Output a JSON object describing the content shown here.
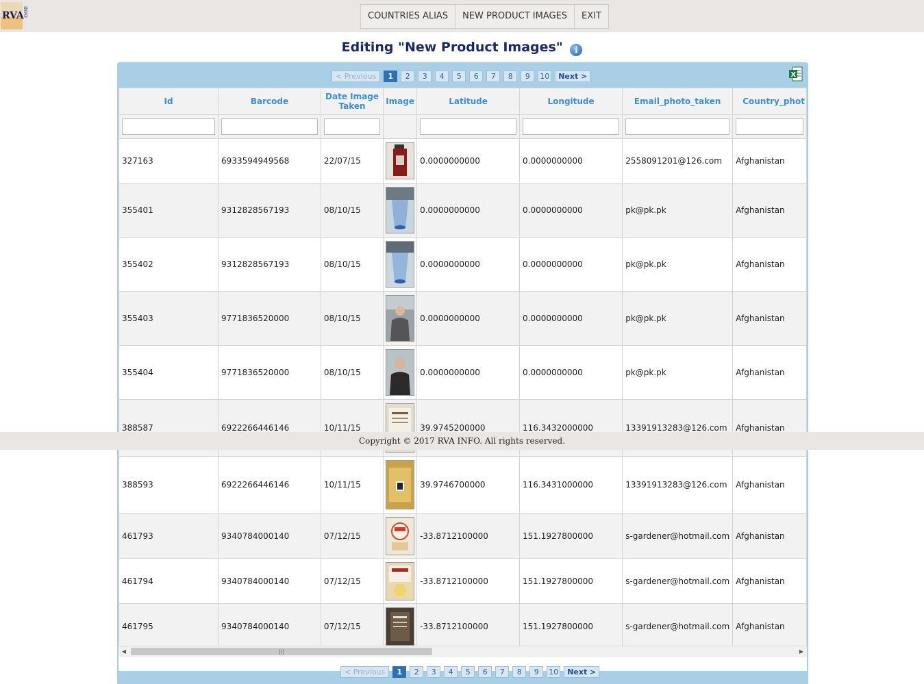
{
  "app": {
    "logo_text": "RVA INFO"
  },
  "nav": {
    "items": [
      "COUNTRIES ALIAS",
      "NEW PRODUCT IMAGES",
      "EXIT"
    ]
  },
  "page_title": "Editing \"New Product Images\"",
  "pager": {
    "prev_label": "< Previous",
    "next_label": "Next >",
    "pages": [
      "1",
      "2",
      "3",
      "4",
      "5",
      "6",
      "7",
      "8",
      "9",
      "10"
    ],
    "current": "1"
  },
  "table": {
    "columns": [
      "Id",
      "Barcode",
      "Date Image Taken",
      "Image",
      "Latitude",
      "Longitude",
      "Email_photo_taken",
      "Country_phot"
    ],
    "rows": [
      {
        "id": "327163",
        "barcode": "6933594949568",
        "date": "22/07/15",
        "image": "red-wrapped-snack",
        "lat": "0.0000000000",
        "lon": "0.0000000000",
        "email": "2558091201@126.com",
        "country": "Afghanistan"
      },
      {
        "id": "355401",
        "barcode": "9312828567193",
        "date": "08/10/15",
        "image": "blue-cup",
        "lat": "0.0000000000",
        "lon": "0.0000000000",
        "email": "pk@pk.pk",
        "country": "Afghanistan"
      },
      {
        "id": "355402",
        "barcode": "9312828567193",
        "date": "08/10/15",
        "image": "blue-cup",
        "lat": "0.0000000000",
        "lon": "0.0000000000",
        "email": "pk@pk.pk",
        "country": "Afghanistan"
      },
      {
        "id": "355403",
        "barcode": "9771836520000",
        "date": "08/10/15",
        "image": "person-photo",
        "lat": "0.0000000000",
        "lon": "0.0000000000",
        "email": "pk@pk.pk",
        "country": "Afghanistan"
      },
      {
        "id": "355404",
        "barcode": "9771836520000",
        "date": "08/10/15",
        "image": "person-photo",
        "lat": "0.0000000000",
        "lon": "0.0000000000",
        "email": "pk@pk.pk",
        "country": "Afghanistan"
      },
      {
        "id": "388587",
        "barcode": "6922266446146",
        "date": "10/11/15",
        "image": "package-label",
        "lat": "39.9745200000",
        "lon": "116.3432000000",
        "email": "13391913283@126.com",
        "country": "Afghanistan"
      },
      {
        "id": "388593",
        "barcode": "6922266446146",
        "date": "10/11/15",
        "image": "gold-package",
        "lat": "39.9746700000",
        "lon": "116.3431000000",
        "email": "13391913283@126.com",
        "country": "Afghanistan"
      },
      {
        "id": "461793",
        "barcode": "9340784000140",
        "date": "07/12/15",
        "image": "food-packet",
        "lat": "-33.8712100000",
        "lon": "151.1927800000",
        "email": "s-gardener@hotmail.com",
        "country": "Afghanistan"
      },
      {
        "id": "461794",
        "barcode": "9340784000140",
        "date": "07/12/15",
        "image": "risotto-box",
        "lat": "-33.8712100000",
        "lon": "151.1927800000",
        "email": "s-gardener@hotmail.com",
        "country": "Afghanistan"
      },
      {
        "id": "461795",
        "barcode": "9340784000140",
        "date": "07/12/15",
        "image": "dark-package",
        "lat": "-33.8712100000",
        "lon": "151.1927800000",
        "email": "s-gardener@hotmail.com",
        "country": "Afghanistan"
      }
    ]
  },
  "icons": {
    "info": "info-icon",
    "excel": "excel-export-icon"
  },
  "footer": {
    "copyright": "Copyright © 2017 RVA INFO. All rights reserved."
  },
  "colors": {
    "panel": "#a9cfe6",
    "header_text": "#3c8fd6",
    "title": "#1c2a63",
    "current_page": "#2f6fb5"
  }
}
